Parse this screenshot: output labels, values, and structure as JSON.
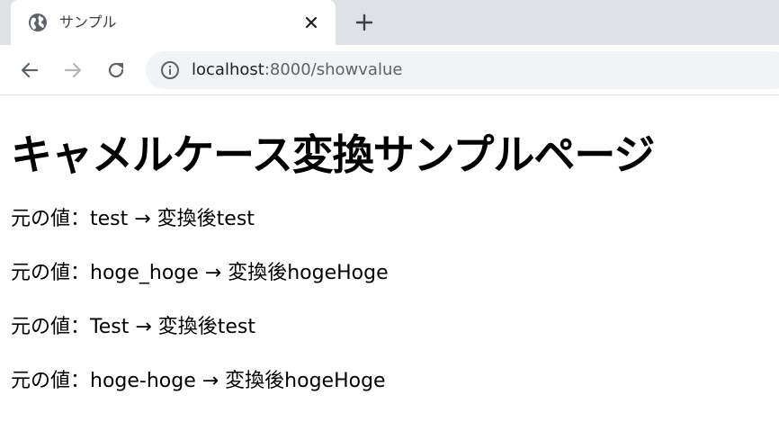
{
  "browser": {
    "tab": {
      "title": "サンプル",
      "favicon": "globe-icon",
      "close_icon": "close-icon"
    },
    "new_tab_icon": "plus-icon",
    "toolbar": {
      "back_icon": "arrow-left-icon",
      "forward_icon": "arrow-right-icon",
      "reload_icon": "reload-icon",
      "site_info_icon": "info-icon",
      "url_host": "localhost",
      "url_rest": ":8000/showvalue"
    },
    "colors": {
      "tabstrip": "#dee1e6",
      "omnibox": "#f1f3f4",
      "icon": "#5f6368",
      "icon_disabled": "#b4b6b8"
    }
  },
  "page": {
    "heading": "キャメルケース変換サンプルページ",
    "results": [
      "元の値：test → 変換後test",
      "元の値：hoge_hoge → 変換後hogeHoge",
      "元の値：Test → 変換後test",
      "元の値：hoge-hoge → 変換後hogeHoge"
    ]
  }
}
